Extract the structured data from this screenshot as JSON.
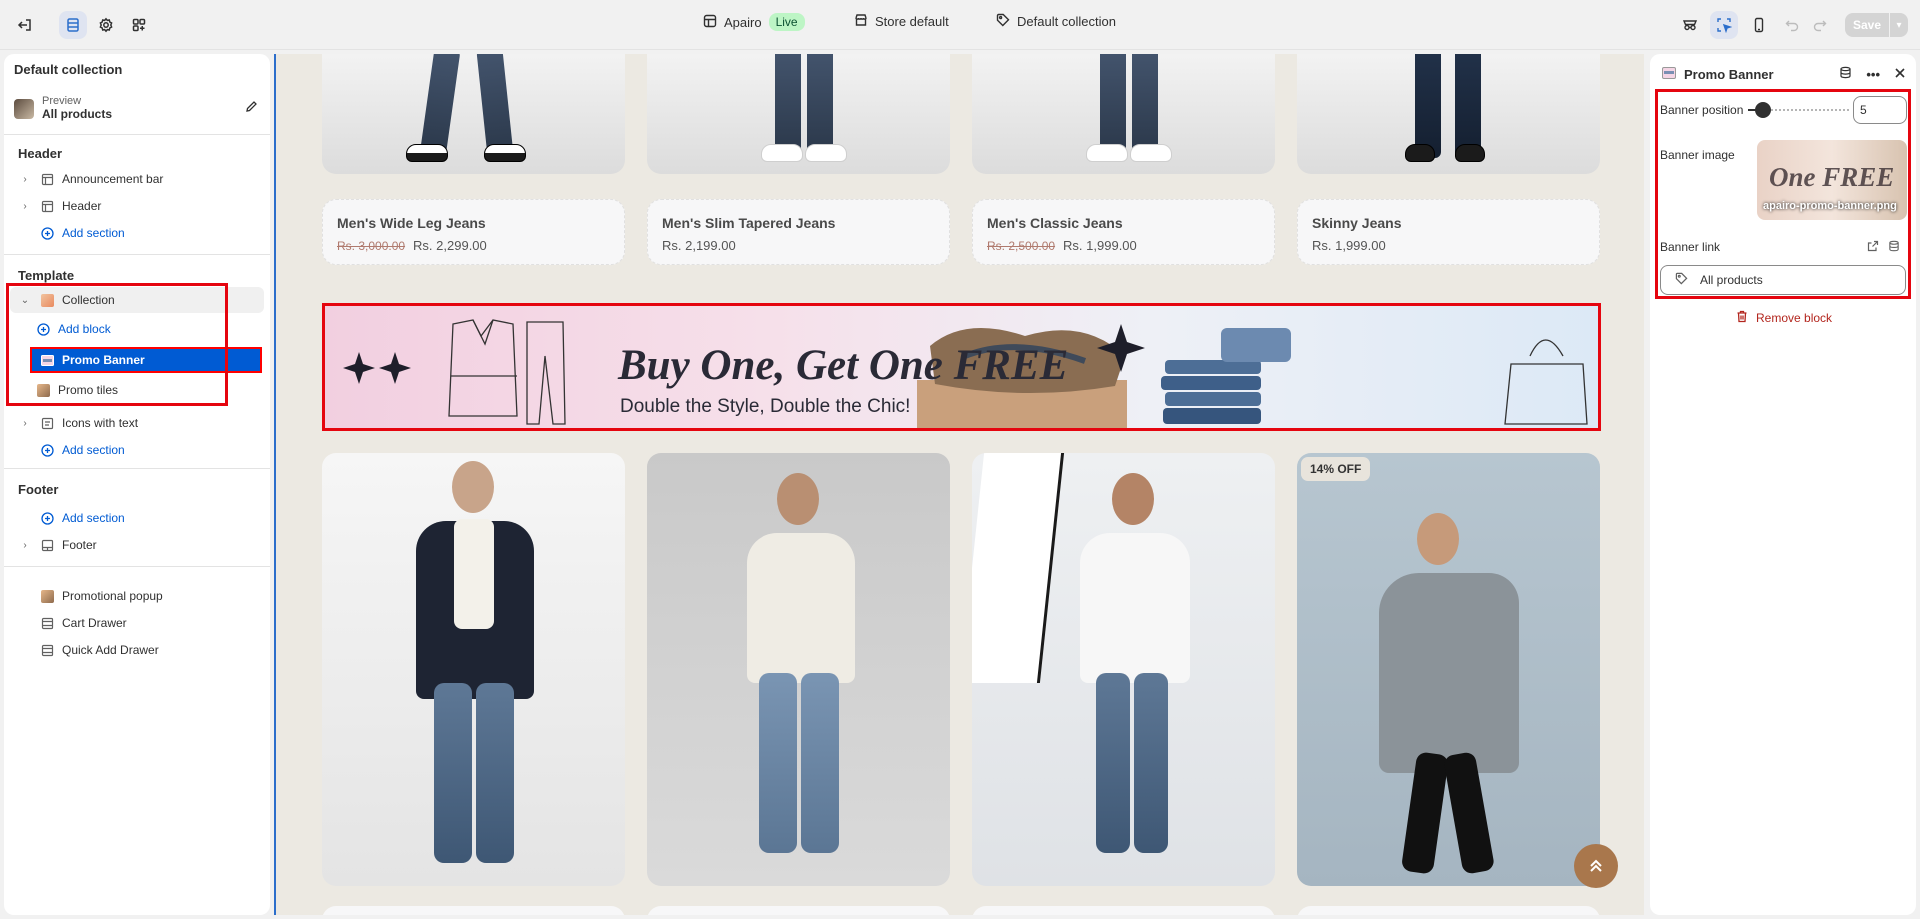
{
  "topbar": {
    "store_name": "Apairo",
    "live_label": "Live",
    "store_default": "Store default",
    "collection_label": "Default collection",
    "save_label": "Save"
  },
  "left": {
    "title": "Default collection",
    "preview_label": "Preview",
    "preview_value": "All products",
    "header_group": "Header",
    "header_items": [
      "Announcement bar",
      "Header"
    ],
    "add_section": "Add section",
    "template_group": "Template",
    "collection_label": "Collection",
    "add_block": "Add block",
    "promo_banner": "Promo Banner",
    "promo_tiles": "Promo tiles",
    "icons_with_text": "Icons with text",
    "footer_group": "Footer",
    "footer_item": "Footer",
    "overlays": [
      "Promotional popup",
      "Cart Drawer",
      "Quick Add Drawer"
    ]
  },
  "canvas": {
    "products": [
      {
        "name": "Men's Wide Leg Jeans",
        "old": "Rs. 3,000.00",
        "price": "Rs. 2,299.00"
      },
      {
        "name": "Men's Slim Tapered Jeans",
        "old": "",
        "price": "Rs. 2,199.00"
      },
      {
        "name": "Men's Classic Jeans",
        "old": "Rs. 2,500.00",
        "price": "Rs. 1,999.00"
      },
      {
        "name": "Skinny Jeans",
        "old": "",
        "price": "Rs. 1,999.00"
      }
    ],
    "banner_title": "Buy One, Get One FREE",
    "banner_subtitle": "Double the Style, Double the Chic!",
    "discount_badge": "14% OFF"
  },
  "right": {
    "title": "Promo Banner",
    "banner_position_label": "Banner position",
    "banner_position_value": "5",
    "banner_image_label": "Banner image",
    "banner_image_text": "One FREE",
    "banner_image_file": "apairo-promo-banner.png",
    "banner_link_label": "Banner link",
    "banner_link_value": "All products",
    "remove_block": "Remove block"
  },
  "colors": {
    "accent": "#005bd3",
    "highlight": "#e5050f",
    "danger": "#b3261e",
    "canvas_bg": "#ece9e2"
  }
}
